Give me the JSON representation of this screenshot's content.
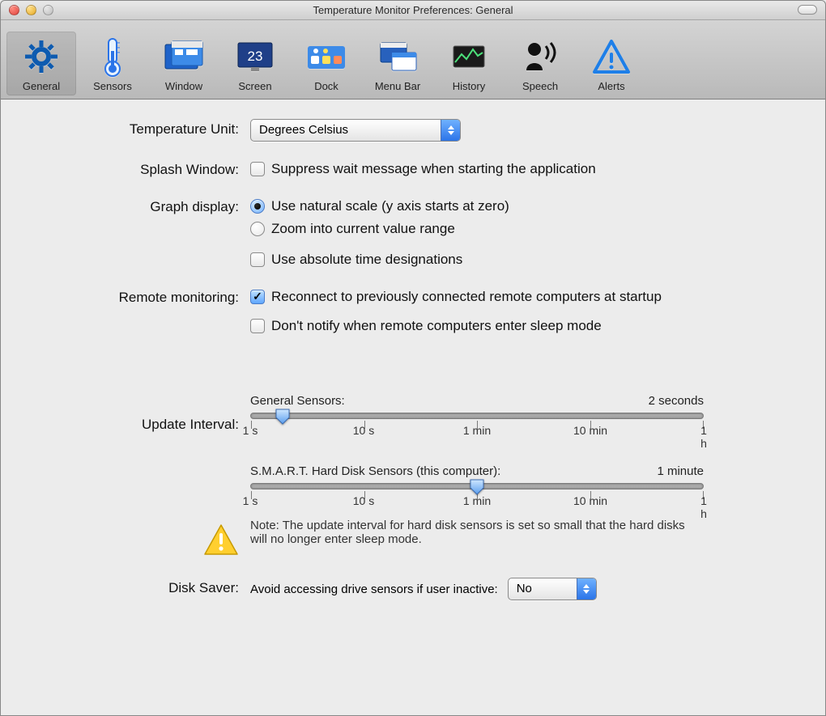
{
  "window_title": "Temperature Monitor Preferences: General",
  "toolbar": [
    {
      "label": "General",
      "icon": "gear-icon",
      "selected": true
    },
    {
      "label": "Sensors",
      "icon": "thermo-icon",
      "selected": false
    },
    {
      "label": "Window",
      "icon": "window-icon",
      "selected": false
    },
    {
      "label": "Screen",
      "icon": "screen-icon",
      "selected": false
    },
    {
      "label": "Dock",
      "icon": "dock-icon",
      "selected": false
    },
    {
      "label": "Menu Bar",
      "icon": "menubar-icon",
      "selected": false
    },
    {
      "label": "History",
      "icon": "history-icon",
      "selected": false
    },
    {
      "label": "Speech",
      "icon": "speech-icon",
      "selected": false
    },
    {
      "label": "Alerts",
      "icon": "alerts-icon",
      "selected": false
    }
  ],
  "labels": {
    "temperature_unit": "Temperature Unit:",
    "splash_window": "Splash Window:",
    "graph_display": "Graph display:",
    "remote_monitoring": "Remote monitoring:",
    "update_interval": "Update Interval:",
    "disk_saver": "Disk Saver:"
  },
  "temperature_unit": {
    "selected": "Degrees Celsius"
  },
  "splash_window": {
    "suppress_label": "Suppress wait message when starting the application",
    "suppress_checked": false
  },
  "graph_display": {
    "natural_label": "Use natural scale (y axis starts at zero)",
    "zoom_label": "Zoom into current value range",
    "selected": "natural",
    "abs_time_label": "Use absolute time designations",
    "abs_time_checked": false
  },
  "remote_monitoring": {
    "reconnect_label": "Reconnect to previously connected remote computers at startup",
    "reconnect_checked": true,
    "dont_notify_label": "Don't notify when remote computers enter sleep mode",
    "dont_notify_checked": false
  },
  "update_interval": {
    "general": {
      "label": "General Sensors:",
      "value_label": "2 seconds",
      "thumb_pct": 7,
      "ticks": [
        "1 s",
        "10 s",
        "1 min",
        "10 min",
        "1 h"
      ]
    },
    "smart": {
      "label": "S.M.A.R.T. Hard Disk Sensors (this computer):",
      "value_label": "1 minute",
      "thumb_pct": 50,
      "ticks": [
        "1 s",
        "10 s",
        "1 min",
        "10 min",
        "1 h"
      ]
    },
    "note": "Note: The update interval for hard disk sensors is set so small that the hard disks will no longer enter sleep mode."
  },
  "disk_saver": {
    "prompt": "Avoid accessing drive sensors if user inactive:",
    "selected": "No"
  }
}
